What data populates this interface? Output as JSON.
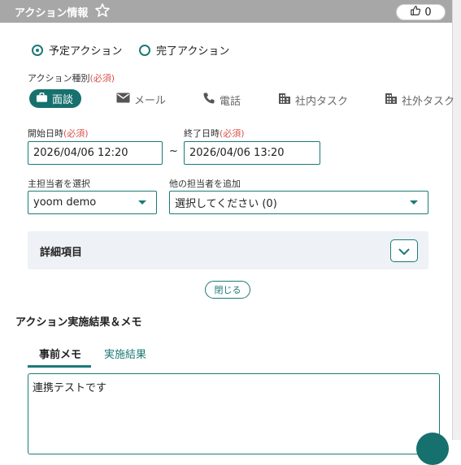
{
  "header": {
    "title": "アクション情報",
    "like_count": "0"
  },
  "action_state": {
    "options": [
      "予定アクション",
      "完了アクション"
    ],
    "selected": "予定アクション"
  },
  "action_type": {
    "label": "アクション種別",
    "required": "(必須)",
    "types": [
      {
        "label": "面談",
        "icon": "briefcase-icon",
        "active": true
      },
      {
        "label": "メール",
        "icon": "mail-icon",
        "active": false
      },
      {
        "label": "電話",
        "icon": "phone-icon",
        "active": false
      },
      {
        "label": "社内タスク",
        "icon": "building-icon",
        "active": false
      },
      {
        "label": "社外タスク",
        "icon": "building-icon",
        "active": false
      }
    ]
  },
  "start": {
    "label": "開始日時",
    "required": "(必須)",
    "value": "2026/04/06 12:20"
  },
  "range_sep": "~",
  "end": {
    "label": "終了日時",
    "required": "(必須)",
    "value": "2026/04/06 13:20"
  },
  "owner": {
    "label": "主担当者を選択",
    "value": "yoom demo"
  },
  "others": {
    "label": "他の担当者を追加",
    "value": "選択してください (0)"
  },
  "details": {
    "title": "詳細項目"
  },
  "close_label": "閉じる",
  "result_section": {
    "title": "アクション実施結果＆メモ",
    "tabs": [
      "事前メモ",
      "実施結果"
    ],
    "active_tab": "事前メモ",
    "memo_text": "連携テストです"
  },
  "colors": {
    "accent": "#1b7a78",
    "header_bg": "#a7a7a7",
    "required": "#d9534f"
  }
}
